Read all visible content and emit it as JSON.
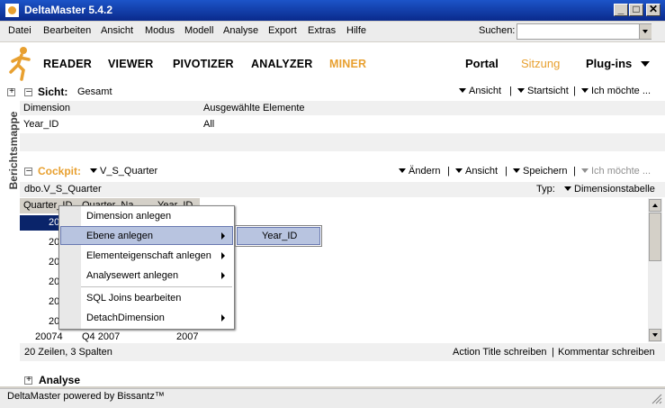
{
  "window": {
    "title": "DeltaMaster 5.4.2",
    "min_glyph": "_",
    "max_glyph": "□",
    "close_glyph": "✕"
  },
  "menu": {
    "items": [
      "Datei",
      "Bearbeiten",
      "Ansicht",
      "Modus",
      "Modell",
      "Analyse",
      "Export",
      "Extras",
      "Hilfe"
    ],
    "search_label": "Suchen:",
    "search_value": ""
  },
  "nav": {
    "tabs": [
      "READER",
      "VIEWER",
      "PIVOTIZER",
      "ANALYZER",
      "MINER"
    ],
    "active_tab": "MINER",
    "right": [
      "Portal",
      "Sitzung",
      "Plug-ins"
    ],
    "active_right": "Sitzung"
  },
  "sidebar": {
    "label": "Berichtsmappe"
  },
  "sicht": {
    "expander": "–",
    "title": "Sicht:",
    "value": "Gesamt",
    "tools": [
      "Ansicht",
      "Startsicht",
      "Ich möchte ..."
    ],
    "columns": [
      "Dimension",
      "Ausgewählte Elemente"
    ],
    "rows": [
      [
        "Year_ID",
        "All"
      ]
    ]
  },
  "cockpit": {
    "expander": "–",
    "title": "Cockpit:",
    "value": "V_S_Quarter",
    "tools": [
      "Ändern",
      "Ansicht",
      "Speichern",
      "Ich möchte ..."
    ],
    "source": "dbo.V_S_Quarter",
    "type_label": "Typ:",
    "type_value": "Dimensionstabelle",
    "table_header": [
      "Quarter_ID",
      "Quarter_Na",
      "Year_ID"
    ],
    "rows": [
      [
        "20",
        ""
      ],
      [
        "20",
        ""
      ],
      [
        "20",
        ""
      ],
      [
        "20",
        ""
      ],
      [
        "20",
        ""
      ],
      [
        "20",
        ""
      ],
      [
        "20074",
        "Q4 2007",
        "2007"
      ]
    ],
    "status": "20 Zeilen, 3 Spalten",
    "action1": "Action Title schreiben",
    "action2": "Kommentar schreiben"
  },
  "context_menu": {
    "items": [
      "Dimension anlegen",
      "Ebene anlegen",
      "Elementeigenschaft anlegen",
      "Analysewert anlegen",
      "SQL Joins bearbeiten",
      "DetachDimension"
    ],
    "submenu": [
      "Year_ID"
    ]
  },
  "analyse": {
    "expander": "+",
    "title": "Analyse"
  },
  "status": {
    "text": "DeltaMaster powered by Bissantz™"
  },
  "colors": {
    "accent": "#e8a030",
    "titlebar": "#0a2a8c"
  }
}
